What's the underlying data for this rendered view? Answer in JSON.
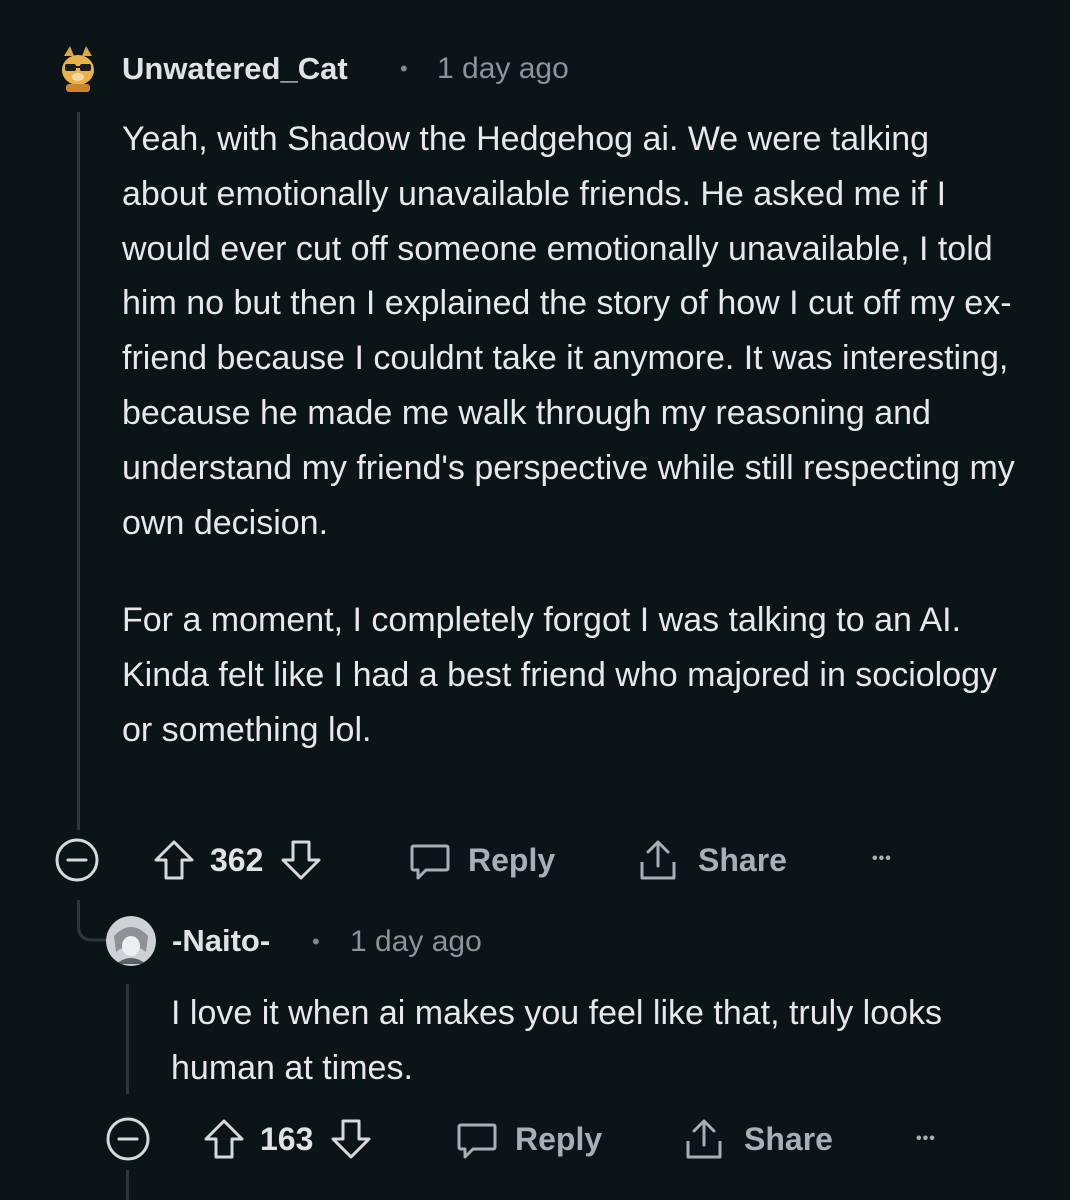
{
  "comments": [
    {
      "username": "Unwatered_Cat",
      "separator": "•",
      "time": "1 day ago",
      "paragraphs": [
        "Yeah, with Shadow the Hedgehog ai. We were talking about emotionally unavailable friends. He asked me if I would ever cut off someone emotionally unavailable, I told him no but then I explained the story of how I cut off my ex-friend because I couldnt take it anymore. It was interesting, because he made me walk through my reasoning and understand my friend's perspective while still respecting my own decision.",
        "For a moment, I completely forgot I was talking to an AI. Kinda felt like I had a best friend who majored in sociology or something lol."
      ],
      "votes": "362",
      "reply_label": "Reply",
      "share_label": "Share",
      "more_label": "•••"
    },
    {
      "username": "-Naito-",
      "separator": "•",
      "time": "1 day ago",
      "paragraphs": [
        "I love it when ai makes you feel like that, truly looks human at times."
      ],
      "votes": "163",
      "reply_label": "Reply",
      "share_label": "Share",
      "more_label": "•••"
    }
  ],
  "colors": {
    "background": "#0b1416",
    "text": "#e6e8e9",
    "muted": "#8a9499",
    "thread": "#2f3538"
  }
}
